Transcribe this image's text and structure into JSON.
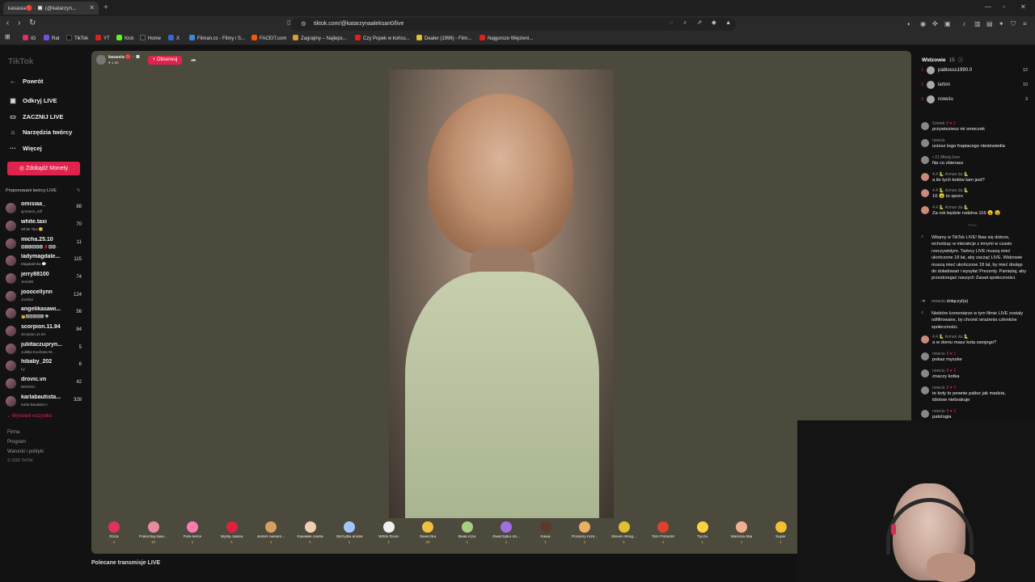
{
  "browser": {
    "tab_title": "kasasia🔴 · 🔲 (@katarzyn...",
    "url": "tiktok.com/@katarzynaaleksan0/live",
    "bookmarks": [
      {
        "label": "IG",
        "color": "#d6306e"
      },
      {
        "label": "Rat",
        "color": "#7a4be0"
      },
      {
        "label": "TikTok",
        "color": "#111111"
      },
      {
        "label": "YT",
        "color": "#e02020"
      },
      {
        "label": "Kick",
        "color": "#53fc18"
      },
      {
        "label": "Home",
        "color": "#222222"
      },
      {
        "label": "X",
        "color": "#2a6bd8"
      },
      {
        "label": "Filman.cc - Filmy i S...",
        "color": "#3a8ad8"
      },
      {
        "label": "FACEIT.com",
        "color": "#ff5500"
      },
      {
        "label": "Zagrajmy – Najleps...",
        "color": "#d8a030"
      },
      {
        "label": "Czy Popek w końcu...",
        "color": "#e02020"
      },
      {
        "label": "Dealer (1996) - Film...",
        "color": "#e0c030"
      },
      {
        "label": "Najgorsze Więzieni...",
        "color": "#e02020"
      }
    ]
  },
  "sidebar": {
    "logo": "TikTok",
    "back_label": "Powrót",
    "nav": [
      {
        "label": "Odkryj LIVE",
        "icon": "live-icon"
      },
      {
        "label": "ZACZNIJ LIVE",
        "icon": "camera-icon"
      },
      {
        "label": "Narzędzia twórcy",
        "icon": "bulb-icon"
      },
      {
        "label": "Więcej",
        "icon": "more-icon"
      }
    ],
    "coins_button": "Zdobądź Monety",
    "proposed_title": "Proponowani twórcy LIVE",
    "creators": [
      {
        "name": "omisiaa_",
        "sub": "ig:naomi_szll",
        "count": "88"
      },
      {
        "name": "white.taxi",
        "sub": "White Taxi 😊",
        "count": "70"
      },
      {
        "name": "micha.25.10",
        "sub": "🅼🅸🅲🅷🅰🅻 🌹🅼🅰...",
        "count": "11"
      },
      {
        "name": "ladymagdale...",
        "sub": "Magdalenka 💬",
        "count": "115"
      },
      {
        "name": "jerry88100",
        "sub": "Jerry88",
        "count": "74"
      },
      {
        "name": "jooocellynn",
        "sub": "Jocelyn",
        "count": "124"
      },
      {
        "name": "angelikasawi...",
        "sub": "👑🅰🅽🅶🅴🅻 💎",
        "count": "56"
      },
      {
        "name": "scorpion.11.94",
        "sub": "Scorpion.11.94",
        "count": "84"
      },
      {
        "name": "juliitaczupryn...",
        "sub": "Juliitka Kochana W...",
        "count": "5"
      },
      {
        "name": "hibaby_202",
        "sub": "Ly",
        "count": "6"
      },
      {
        "name": "drovic.vn",
        "sub": "DROVIC.",
        "count": "42"
      },
      {
        "name": "karlabautista...",
        "sub": "Karla Bautista🎶",
        "count": "328"
      }
    ],
    "show_all": "Wyświetl wszystko",
    "footer": [
      "Firma",
      "Program",
      "Warunki i polityki",
      "© 2025 TikTok"
    ]
  },
  "stream": {
    "host_name": "kasasia 🔴 · 🔲",
    "host_likes": "♥ 1.5K",
    "follow_label": "+ Obserwuj",
    "recommended": "Polecane transmisje LIVE"
  },
  "gifts": [
    {
      "name": "Róża",
      "price": "1",
      "color": "#e0335a"
    },
    {
      "name": "Pokochaj świe...",
      "price": "10",
      "color": "#e88aa0"
    },
    {
      "name": "Puls-serce",
      "price": "1",
      "color": "#ff7ab0"
    },
    {
      "name": "Wyślij całusa",
      "price": "1",
      "color": "#e02040"
    },
    {
      "name": "Jesteś niesam...",
      "price": "1",
      "color": "#d8a060"
    },
    {
      "name": "Kawałek ciasta",
      "price": "1",
      "color": "#f0d0b0"
    },
    {
      "name": "Skrzydła anioła",
      "price": "1",
      "color": "#9fc6ff"
    },
    {
      "name": "White Dove",
      "price": "1",
      "color": "#f0f0f0"
    },
    {
      "name": "Świeczka",
      "price": "20",
      "color": "#f2c040"
    },
    {
      "name": "Biała róża",
      "price": "1",
      "color": "#a8d080"
    },
    {
      "name": "Zwierzątko ob...",
      "price": "1",
      "color": "#a070e0"
    },
    {
      "name": "Kawa",
      "price": "1",
      "color": "#5a3a2a"
    },
    {
      "name": "Poranny rozk...",
      "price": "1",
      "color": "#e8b060"
    },
    {
      "name": "Steven Wing...",
      "price": "1",
      "color": "#e0c030"
    },
    {
      "name": "Tom Pomidor",
      "price": "1",
      "color": "#e04030"
    },
    {
      "name": "Tęcza",
      "price": "1",
      "color": "#ffd040"
    },
    {
      "name": "Mamma Mia",
      "price": "1",
      "color": "#f0b090"
    },
    {
      "name": "Super",
      "price": "1",
      "color": "#f0c030"
    }
  ],
  "chat": {
    "viewers_title": "Widzowie",
    "viewers_count": "15",
    "viewers": [
      {
        "rank": "1",
        "name": "pablosss1990.0",
        "score": "12"
      },
      {
        "rank": "2",
        "name": "larton",
        "score": "10"
      },
      {
        "rank": "3",
        "name": "nowciu",
        "score": "3"
      }
    ],
    "messages": [
      {
        "user": "Szmek",
        "badge": "8 ♥ 3",
        "text": "przywieziesz mi smoczek"
      },
      {
        "user": "nowciu",
        "badge": "",
        "text": "uciesz tego frapiacego niedzwiedia"
      },
      {
        "user": "• 21  MłodyJove",
        "badge": "",
        "text": "Na co zbierasz"
      },
      {
        "user": "4.4  🐍 Arman da 🐍",
        "badge": "",
        "text": "a ile tych kotów tam jest?"
      },
      {
        "user": "4.4  🐍 Arman da 🐍",
        "badge": "",
        "text": "16 😮 to sporo"
      },
      {
        "user": "4.4  🐍 Arman da 🐍",
        "badge": "",
        "text": "Za rok będzie rodzina 116 😮 😮"
      }
    ],
    "system_notice": "Witamy w TikTok LIVE! Baw się dobrze, wchodząc w interakcje z innymi w czasie rzeczywistym. Twórcy LIVE muszą mieć ukończone 18 lat, aby zacząć LIVE. Widzowie muszą mieć ukończone 18 lat, by mieć dostęp do doładowań i wysyłać Prezenty. Pamiętaj, aby przestrzegać naszych Zasad społeczności.",
    "joined_user": "nowciu",
    "joined_text": "dołączył(a)",
    "filter_notice": "Niektóre komentarze w tym filmie LIVE zostały odfiltrowane, by chronić wrażenia członków społeczności.",
    "messages2": [
      {
        "user": "4.4  🐍 Arman da 🐍",
        "badge": "",
        "text": "a w domu masz kota swojego?"
      },
      {
        "user": "nowciu",
        "badge": "8 ♥ 3",
        "text": "pokaz myszke"
      },
      {
        "user": "nowciu",
        "badge": "8 ♥ 3",
        "text": "znaczy kotka"
      },
      {
        "user": "nowciu",
        "badge": "8 ♥ 3",
        "text": "te koty to pewnie palisz jak madzia,"
      },
      {
        "user": "",
        "badge": "",
        "text": "idiotow niebrakuje"
      },
      {
        "user": "nowciu",
        "badge": "8 ♥ 3",
        "text": "patologia"
      }
    ],
    "time_label": "Teraz"
  }
}
